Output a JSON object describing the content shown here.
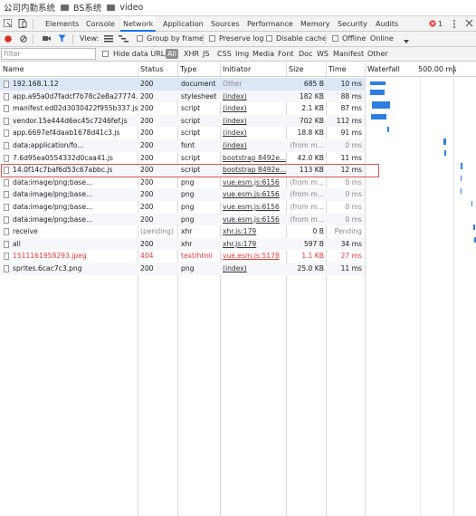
{
  "breadcrumb": [
    "公司内勤系统",
    "BS系统",
    "video"
  ],
  "tabs": [
    "Elements",
    "Console",
    "Network",
    "Application",
    "Sources",
    "Performance",
    "Memory",
    "Security",
    "Audits"
  ],
  "active_tab": "Network",
  "error_count": "1",
  "toolbar": {
    "view_label": "View:",
    "group_by_frame": "Group by frame",
    "preserve_log": "Preserve log",
    "disable_cache": "Disable cache",
    "offline": "Offline",
    "throttle": "Online"
  },
  "filter": {
    "placeholder": "Filter",
    "hide_data_urls": "Hide data URLs",
    "types": [
      "All",
      "XHR",
      "JS",
      "CSS",
      "Img",
      "Media",
      "Font",
      "Doc",
      "WS",
      "Manifest",
      "Other"
    ]
  },
  "columns": {
    "name": "Name",
    "status": "Status",
    "type": "Type",
    "initiator": "Initiator",
    "size": "Size",
    "time": "Time",
    "waterfall": "Waterfall",
    "waterfall_scale": "500.00 ms"
  },
  "rows": [
    {
      "name": "192.168.1.12",
      "status": "200",
      "type": "document",
      "initiator": "Other",
      "size": "685 B",
      "time": "10 ms"
    },
    {
      "name": "app.a95a0d7fadcf7b78c2e8a27774...",
      "status": "200",
      "type": "stylesheet",
      "initiator": "(index)",
      "size": "182 KB",
      "time": "88 ms"
    },
    {
      "name": "manifest.ed02d3030422f955b337.js",
      "status": "200",
      "type": "script",
      "initiator": "(index)",
      "size": "2.1 KB",
      "time": "87 ms"
    },
    {
      "name": "vendor.15e444d6ec45c7246fef.js",
      "status": "200",
      "type": "script",
      "initiator": "(index)",
      "size": "702 KB",
      "time": "112 ms"
    },
    {
      "name": "app.6697ef4daab1678d41c3.js",
      "status": "200",
      "type": "script",
      "initiator": "(index)",
      "size": "18.8 KB",
      "time": "91 ms"
    },
    {
      "name": "data:application/fo...",
      "status": "200",
      "type": "font",
      "initiator": "(index)",
      "size": "(from m...",
      "time": "0 ms"
    },
    {
      "name": "7.6d95ea0554332d0caa41.js",
      "status": "200",
      "type": "script",
      "initiator": "bootstrap 8492e...",
      "size": "42.0 KB",
      "time": "11 ms"
    },
    {
      "name": "14.0f14c7baf6d53c67abbc.js",
      "status": "200",
      "type": "script",
      "initiator": "bootstrap 8492e...",
      "size": "113 KB",
      "time": "12 ms"
    },
    {
      "name": "data:image/png;base...",
      "status": "200",
      "type": "png",
      "initiator": "vue.esm.js:6156",
      "size": "(from m...",
      "time": "0 ms"
    },
    {
      "name": "data:image/png;base...",
      "status": "200",
      "type": "png",
      "initiator": "vue.esm.js:6156",
      "size": "(from m...",
      "time": "0 ms"
    },
    {
      "name": "data:image/png;base...",
      "status": "200",
      "type": "png",
      "initiator": "vue.esm.js:6156",
      "size": "(from m...",
      "time": "0 ms"
    },
    {
      "name": "data:image/png;base...",
      "status": "200",
      "type": "png",
      "initiator": "vue.esm.js:6156",
      "size": "(from m...",
      "time": "0 ms"
    },
    {
      "name": "receive",
      "status": "(pending)",
      "type": "xhr",
      "initiator": "xhr.js:179",
      "size": "0 B",
      "time": "Pending"
    },
    {
      "name": "all",
      "status": "200",
      "type": "xhr",
      "initiator": "xhr.js:179",
      "size": "597 B",
      "time": "34 ms"
    },
    {
      "name": "1511161958293.jpeg",
      "status": "404",
      "type": "text/html",
      "initiator": "vue.esm.js:5178",
      "size": "1.1 KB",
      "time": "27 ms"
    },
    {
      "name": "sprites.6cac7c3.png",
      "status": "200",
      "type": "png",
      "initiator": "(index)",
      "size": "25.0 KB",
      "time": "11 ms"
    }
  ],
  "colors": {
    "accent": "#1a73e8",
    "error": "#e53935",
    "waterfall_bar": "#2f7de1",
    "selected_row": "#dbe6f7",
    "highlight_border": "#d9534f"
  }
}
